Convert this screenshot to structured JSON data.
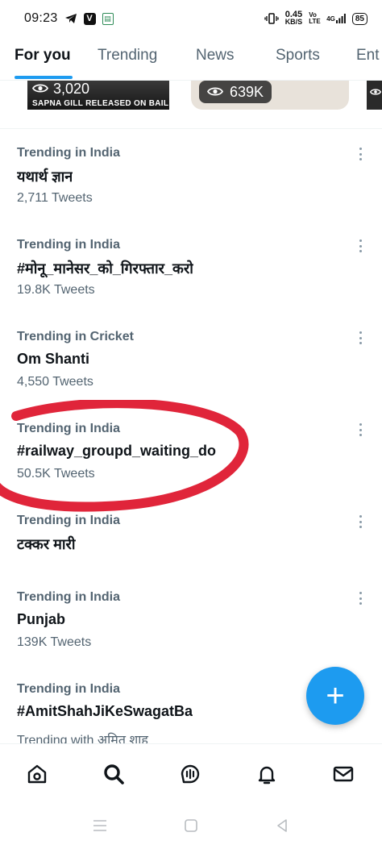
{
  "status_bar": {
    "time": "09:23",
    "network_speed": "0.45",
    "network_speed_unit": "KB/S",
    "volte": "Vo LTE",
    "signal": "4G",
    "battery": "85"
  },
  "tabs": [
    {
      "label": "For you",
      "active": true
    },
    {
      "label": "Trending",
      "active": false
    },
    {
      "label": "News",
      "active": false
    },
    {
      "label": "Sports",
      "active": false
    },
    {
      "label": "Ent",
      "active": false
    }
  ],
  "media": {
    "thumb1_views": "3,020",
    "thumb1_caption": "SAPNA GILL RELEASED ON BAIL",
    "thumb2_views": "639K"
  },
  "trends": [
    {
      "context": "Trending in India",
      "name": "यथार्थ ज्ञान",
      "count": "2,711 Tweets"
    },
    {
      "context": "Trending in India",
      "name": "#मोनू_मानेसर_को_गिरफ्तार_करो",
      "count": "19.8K Tweets"
    },
    {
      "context": "Trending in Cricket",
      "name": "Om Shanti",
      "count": "4,550 Tweets"
    },
    {
      "context": "Trending in India",
      "name": "#railway_groupd_waiting_do",
      "count": "50.5K Tweets"
    },
    {
      "context": "Trending in India",
      "name": "टक्कर मारी",
      "count": ""
    },
    {
      "context": "Trending in India",
      "name": "Punjab",
      "count": "139K Tweets"
    },
    {
      "context": "Trending in India",
      "name": "#AmitShahJiKeSwagatBa",
      "count": "Trending with अमित शाह"
    }
  ],
  "fab": {
    "label": "+"
  },
  "colors": {
    "accent": "#1d9bf0",
    "annotation": "#e0253a",
    "secondary_text": "#536471"
  },
  "icons": {
    "nav": [
      "home-icon",
      "search-icon",
      "spaces-icon",
      "notifications-icon",
      "messages-icon"
    ],
    "system": [
      "menu-icon",
      "home-square-icon",
      "back-icon"
    ]
  }
}
